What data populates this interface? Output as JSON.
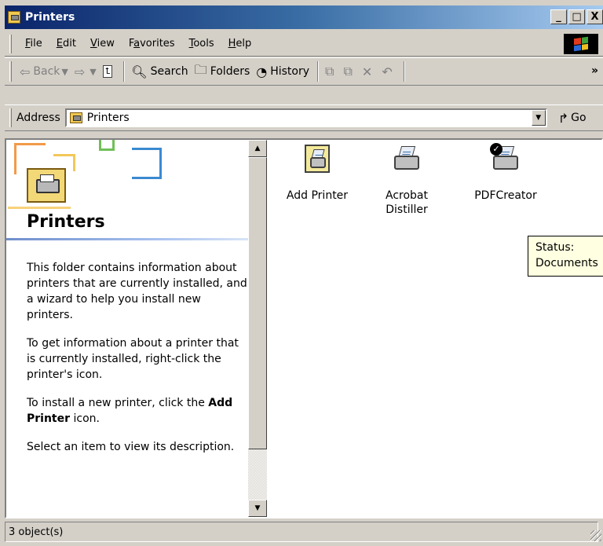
{
  "window": {
    "title": "Printers",
    "controls": {
      "minimize": "_",
      "maximize": "□",
      "close": "X"
    }
  },
  "menu": {
    "items": [
      {
        "label": "File",
        "accel": "F",
        "rest": "ile"
      },
      {
        "label": "Edit",
        "accel": "E",
        "rest": "dit"
      },
      {
        "label": "View",
        "accel": "V",
        "rest": "iew"
      },
      {
        "label": "Favorites",
        "pre": "F",
        "accel": "a",
        "rest": "vorites"
      },
      {
        "label": "Tools",
        "accel": "T",
        "rest": "ools"
      },
      {
        "label": "Help",
        "accel": "H",
        "rest": "elp"
      }
    ]
  },
  "toolbar": {
    "back_label": "Back",
    "search_label": "Search",
    "folders_label": "Folders",
    "history_label": "History",
    "overflow": "»"
  },
  "address": {
    "label": "Address",
    "value": "Printers",
    "go_label": "Go"
  },
  "left_pane": {
    "title": "Printers",
    "paragraphs": [
      "This folder contains information about printers that are currently installed, and a wizard to help you install new printers.",
      "To get information about a printer that is currently installed, right-click the printer's icon."
    ],
    "install_prefix": "To install a new printer, click the",
    "install_bold": "Add Printer",
    "install_suffix": "icon.",
    "select_text": "Select an item to view its description."
  },
  "items": [
    {
      "label": "Add Printer",
      "icon": "add-printer-icon"
    },
    {
      "label": "Acrobat Distiller",
      "icon": "printer-icon"
    },
    {
      "label": "PDFCreator",
      "icon": "default-printer-icon"
    }
  ],
  "tooltip": {
    "line1": "Status:",
    "line2": "Documents"
  },
  "status": {
    "text": "3 object(s)"
  }
}
